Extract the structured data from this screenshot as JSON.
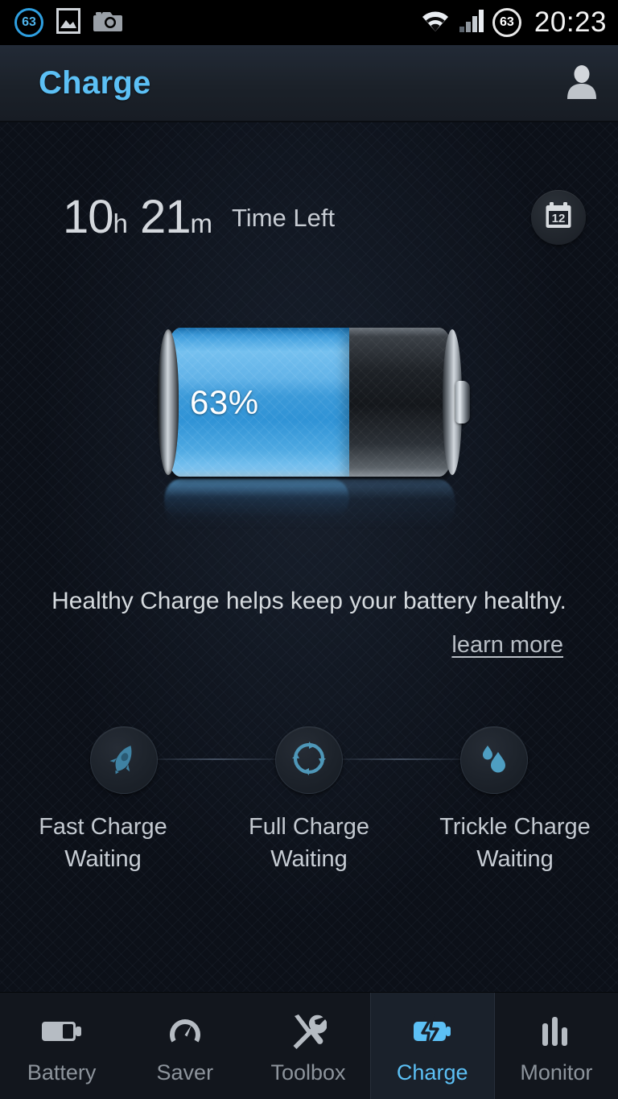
{
  "status_bar": {
    "battery_left_icon": "battery-circle-icon",
    "battery_left_value": "63",
    "gallery_icon": "image-icon",
    "camera_icon": "camera-icon",
    "wifi_icon": "wifi-icon",
    "signal_icon": "cell-signal-icon",
    "battery_right_icon": "battery-circle-icon",
    "battery_right_value": "63",
    "clock": "20:23"
  },
  "title_bar": {
    "title": "Charge",
    "profile_icon": "person-icon"
  },
  "main": {
    "time_left": {
      "hours": "10",
      "hours_unit": "h",
      "minutes": "21",
      "minutes_unit": "m",
      "label": "Time Left"
    },
    "calendar": {
      "icon": "calendar-icon",
      "day": "12"
    },
    "battery": {
      "percent_label": "63%",
      "percent_value": 63,
      "fill_color": "#3e9ddd"
    },
    "healthy_message": "Healthy Charge helps keep your battery healthy.",
    "learn_more": "learn more",
    "stages": [
      {
        "icon": "rocket-icon",
        "title": "Fast Charge",
        "status": "Waiting"
      },
      {
        "icon": "refresh-circle-icon",
        "title": "Full Charge",
        "status": "Waiting"
      },
      {
        "icon": "water-drop-icon",
        "title": "Trickle Charge",
        "status": "Waiting"
      }
    ]
  },
  "bottom_nav": {
    "active_index": 3,
    "active_color": "#5cc0f5",
    "items": [
      {
        "label": "Battery",
        "icon": "battery-icon"
      },
      {
        "label": "Saver",
        "icon": "gauge-icon"
      },
      {
        "label": "Toolbox",
        "icon": "wrench-screwdriver-icon"
      },
      {
        "label": "Charge",
        "icon": "battery-bolt-icon"
      },
      {
        "label": "Monitor",
        "icon": "bar-chart-icon"
      }
    ]
  }
}
